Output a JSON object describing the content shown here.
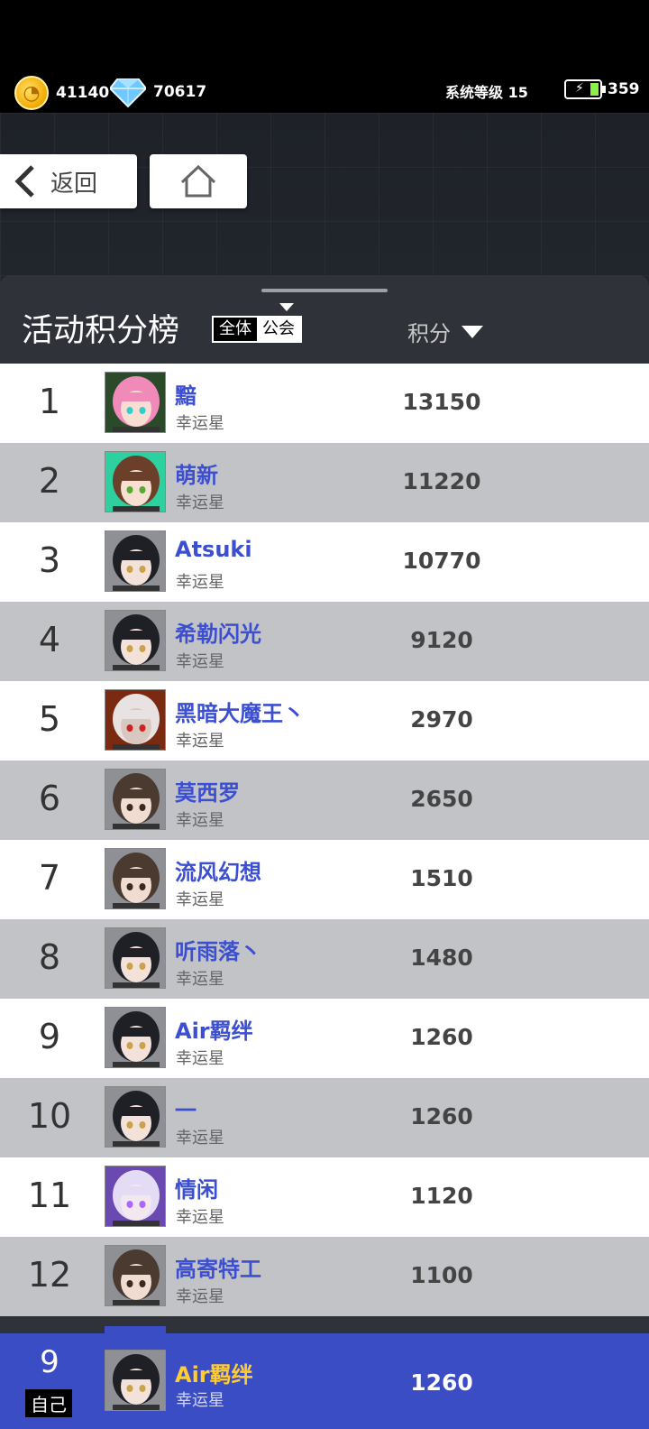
{
  "resources": {
    "coins": "41140",
    "gems": "70617",
    "system_level": "系统等级 15",
    "energy": "359"
  },
  "nav": {
    "back_label": "返回"
  },
  "leaderboard": {
    "title": "活动积分榜",
    "scope_all": "全体",
    "scope_guild": "公会",
    "score_header": "积分",
    "rows": [
      {
        "rank": "1",
        "name": "黯",
        "title": "幸运星",
        "score": "13150",
        "avatar": "pink-hair"
      },
      {
        "rank": "2",
        "name": "萌新",
        "title": "幸运星",
        "score": "11220",
        "avatar": "brown-buns"
      },
      {
        "rank": "3",
        "name": "Atsuki",
        "title": "幸运星",
        "score": "10770",
        "avatar": "dark-girl"
      },
      {
        "rank": "4",
        "name": "希勒闪光",
        "title": "幸运星",
        "score": "9120",
        "avatar": "dark-girl"
      },
      {
        "rank": "5",
        "name": "黑暗大魔王丶",
        "title": "幸运星",
        "score": "2970",
        "avatar": "demon"
      },
      {
        "rank": "6",
        "name": "莫西罗",
        "title": "幸运星",
        "score": "2650",
        "avatar": "boy"
      },
      {
        "rank": "7",
        "name": "流风幻想",
        "title": "幸运星",
        "score": "1510",
        "avatar": "boy"
      },
      {
        "rank": "8",
        "name": "听雨落丶",
        "title": "幸运星",
        "score": "1480",
        "avatar": "dark-girl"
      },
      {
        "rank": "9",
        "name": "Air羁绊",
        "title": "幸运星",
        "score": "1260",
        "avatar": "dark-girl"
      },
      {
        "rank": "10",
        "name": "一",
        "title": "幸运星",
        "score": "1260",
        "avatar": "dark-girl"
      },
      {
        "rank": "11",
        "name": "情闲",
        "title": "幸运星",
        "score": "1120",
        "avatar": "white-hair"
      },
      {
        "rank": "12",
        "name": "高寄特工",
        "title": "幸运星",
        "score": "1100",
        "avatar": "boy"
      }
    ]
  },
  "self_row": {
    "rank": "9",
    "tag": "自己",
    "name": "Air羁绊",
    "title": "幸运星",
    "score": "1260",
    "avatar": "dark-girl"
  }
}
